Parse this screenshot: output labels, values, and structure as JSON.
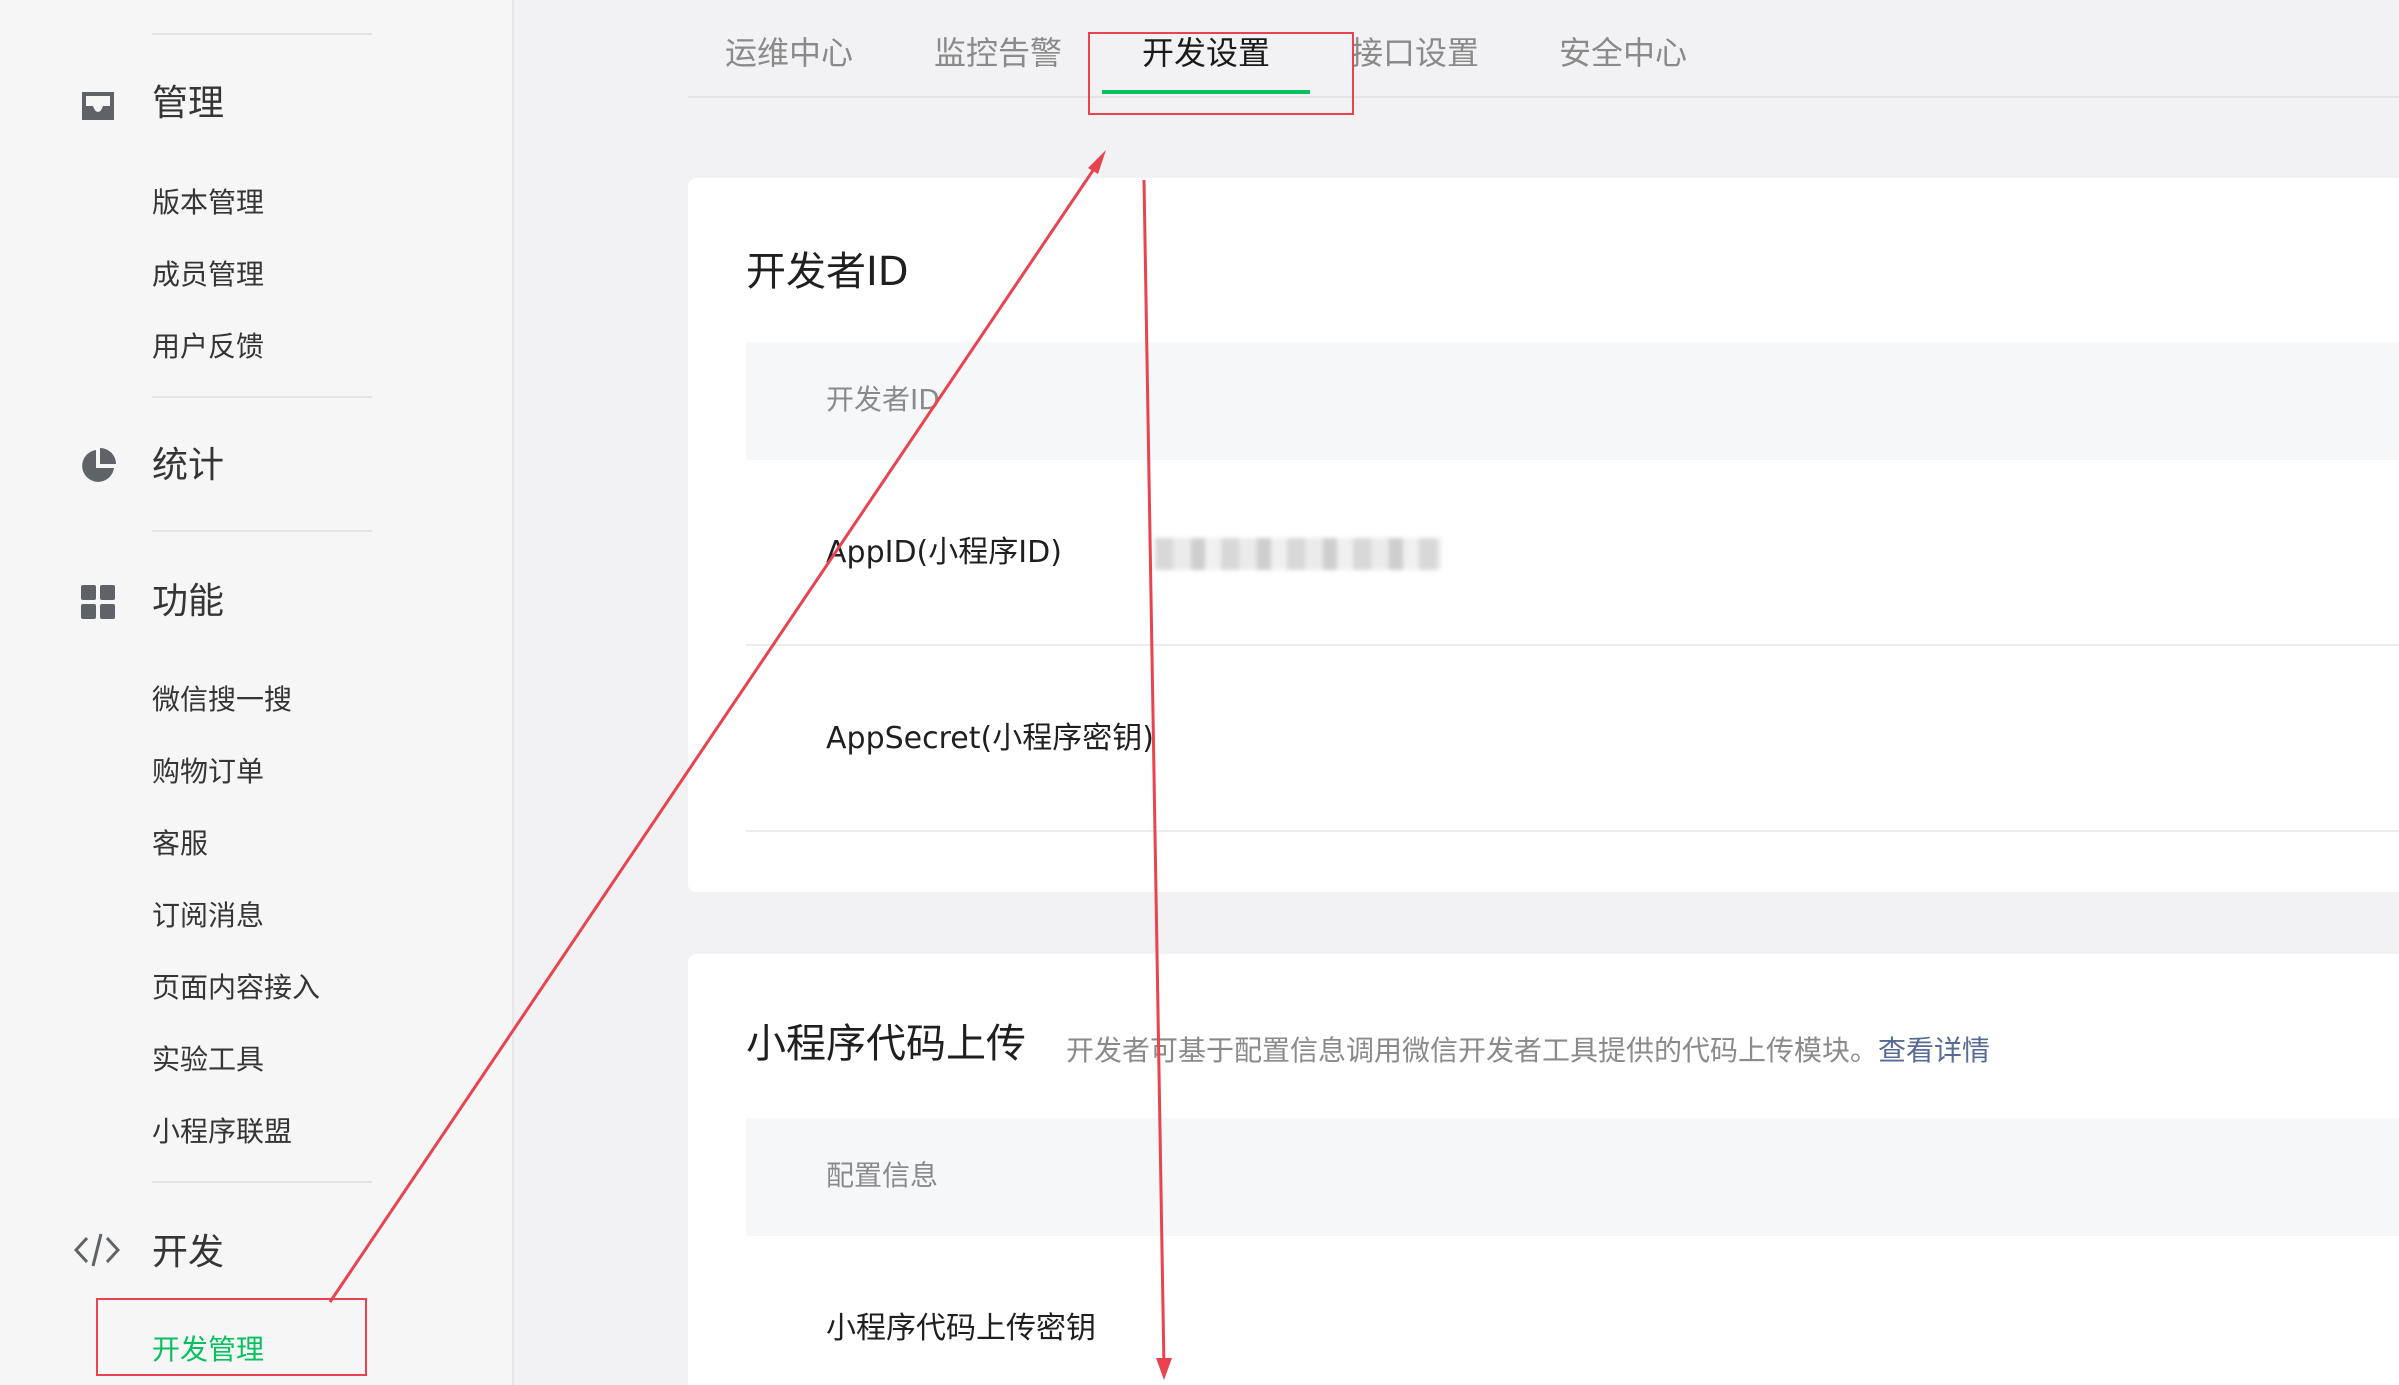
{
  "sidebar": {
    "sections": [
      {
        "title": "管理",
        "icon": "inbox-icon",
        "items": [
          "版本管理",
          "成员管理",
          "用户反馈"
        ]
      },
      {
        "title": "统计",
        "icon": "pie-chart-icon",
        "items": []
      },
      {
        "title": "功能",
        "icon": "grid-icon",
        "items": [
          "微信搜一搜",
          "购物订单",
          "客服",
          "订阅消息",
          "页面内容接入",
          "实验工具",
          "小程序联盟"
        ]
      },
      {
        "title": "开发",
        "icon": "code-icon",
        "items": [
          "开发管理"
        ]
      }
    ],
    "active_item": "开发管理"
  },
  "tabs": [
    "运维中心",
    "监控告警",
    "开发设置",
    "接口设置",
    "安全中心"
  ],
  "active_tab": "开发设置",
  "developer_id_card": {
    "title": "开发者ID",
    "header": "开发者ID",
    "rows": [
      {
        "label": "AppID(小程序ID)"
      },
      {
        "label": "AppSecret(小程序密钥)"
      }
    ]
  },
  "upload_card": {
    "title": "小程序代码上传",
    "description": "开发者可基于配置信息调用微信开发者工具提供的代码上传模块。",
    "link": "查看详情",
    "header": "配置信息",
    "rows": [
      {
        "label": "小程序代码上传密钥"
      }
    ]
  },
  "colors": {
    "accent": "#07c160",
    "annotation": "#e8434f",
    "link": "#576b95"
  }
}
